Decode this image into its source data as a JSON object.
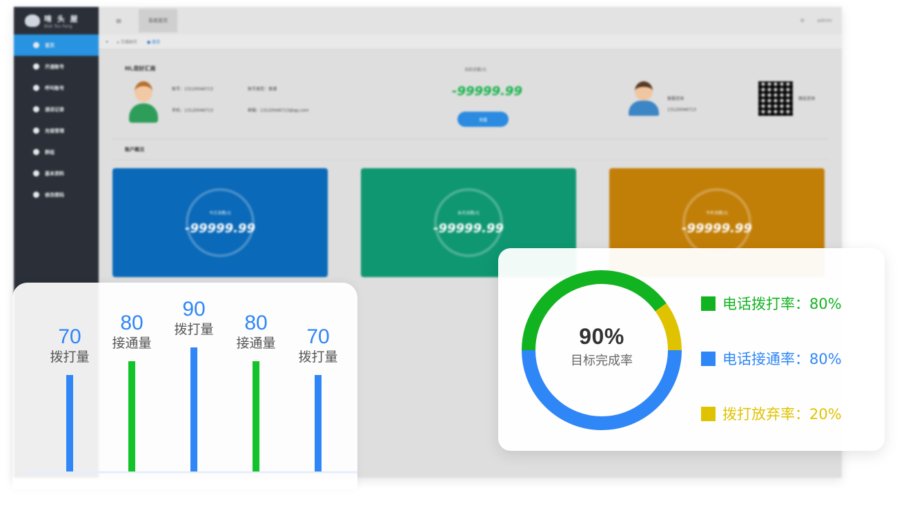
{
  "app": {
    "logo_text": "啃 头 屋",
    "logo_subtext": "Bisk Tou Fang",
    "nav": [
      {
        "label": "首页",
        "active": true
      },
      {
        "label": "开通账号"
      },
      {
        "label": "呼叫账号"
      },
      {
        "label": "通话记录"
      },
      {
        "label": "充值管理"
      },
      {
        "label": "群组"
      },
      {
        "label": "基本资料"
      },
      {
        "label": "修改密码"
      }
    ],
    "topbar": {
      "menu_icon": "≡",
      "tab_label": "系统首页",
      "user": "admin",
      "settings_icon": "⚙"
    },
    "breadcrumbs": [
      "◂",
      "▸ 万德纳号",
      "● 首页"
    ],
    "greeting": "Hi,您好汇商",
    "fields": [
      "账号：13120046713",
      "账号类型：普通",
      "手机：13120046713",
      "邮箱：13120046713@qq.com"
    ],
    "balance_label": "当前余额/元",
    "balance_value": "-99999.99",
    "recharge_label": "充值",
    "service_label": "客服咨询",
    "service_phone": "13120046713",
    "wechat_label": "微信咨询",
    "section_title": "账户概况",
    "cards": [
      {
        "label": "今日消费/元",
        "value": "-99999.99",
        "color": "#0a69b8"
      },
      {
        "label": "本月消费/元",
        "value": "-99999.99",
        "color": "#0f9772"
      },
      {
        "label": "今年消费/元",
        "value": "-99999.99",
        "color": "#c27f08"
      }
    ]
  },
  "chart_data": [
    {
      "type": "bar",
      "categories": [
        "拨打量",
        "接通量",
        "拨打量",
        "接通量",
        "拨打量"
      ],
      "values": [
        70,
        80,
        90,
        80,
        70
      ],
      "colors": [
        "#2f86f6",
        "#12c32a",
        "#2f86f6",
        "#12c32a",
        "#2f86f6"
      ],
      "label_color": "#2f86f6",
      "category_color": "#555555"
    },
    {
      "type": "pie",
      "center_value": "90%",
      "center_caption": "目标完成率",
      "series": [
        {
          "name": "电话拨打率：80%",
          "value": 40,
          "color": "#12b320"
        },
        {
          "name": "拨打放弃率：20%",
          "value": 10,
          "color": "#e0c300"
        },
        {
          "name": "电话接通率：80%",
          "value": 50,
          "color": "#2f86f6"
        }
      ],
      "legend": [
        {
          "label": "电话拨打率：80%",
          "color": "#12b320"
        },
        {
          "label": "电话接通率：80%",
          "color": "#2f86f6"
        },
        {
          "label": "拨打放弃率：20%",
          "color": "#e0c300"
        }
      ]
    }
  ]
}
